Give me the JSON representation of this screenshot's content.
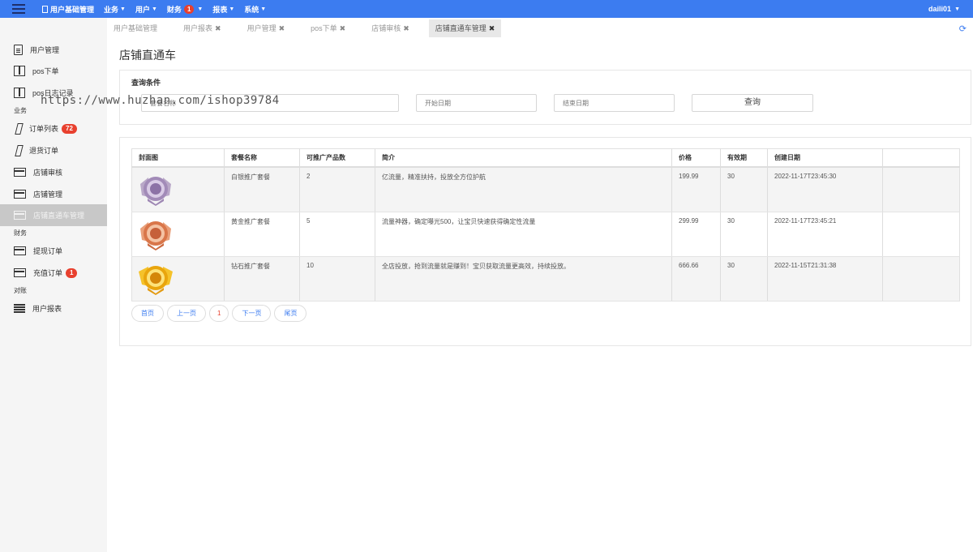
{
  "topbar": {
    "nav": [
      {
        "label": "用户基础管理",
        "icon": "document-icon"
      },
      {
        "label": "业务",
        "caret": true
      },
      {
        "label": "用户",
        "caret": true
      },
      {
        "label": "财务",
        "badge": "1",
        "caret": true
      },
      {
        "label": "报表",
        "caret": true
      },
      {
        "label": "系统",
        "caret": true
      }
    ],
    "user": "daili01",
    "colors": {
      "bar": "#3c7cf0",
      "badge": "#e8402e"
    }
  },
  "sidebar": {
    "items": [
      {
        "label": "用户管理",
        "icon": "document-icon"
      },
      {
        "label": "pos下单",
        "icon": "columns-icon"
      },
      {
        "label": "pos日志记录",
        "icon": "columns-icon"
      },
      {
        "label": "订单列表",
        "icon": "slash-icon",
        "badge": "72"
      },
      {
        "label": "退货订单",
        "icon": "slash-icon"
      },
      {
        "label": "店铺审核",
        "icon": "card-icon"
      },
      {
        "label": "店铺管理",
        "icon": "card-icon"
      },
      {
        "label": "店铺直通车管理",
        "icon": "card-icon",
        "active": true
      },
      {
        "label": "提现订单",
        "icon": "card-icon"
      },
      {
        "label": "充值订单",
        "icon": "card-icon",
        "badge": "1"
      },
      {
        "label": "用户报表",
        "icon": "list-icon"
      }
    ],
    "sections": [
      "业务",
      "财务",
      "对账"
    ]
  },
  "watermark": "https://www.huzhan.com/ishop39784",
  "tabs": [
    {
      "label": "用户基础管理",
      "closable": false
    },
    {
      "label": "用户报表",
      "closable": true
    },
    {
      "label": "用户管理",
      "closable": true
    },
    {
      "label": "pos下单",
      "closable": true
    },
    {
      "label": "店铺审核",
      "closable": true
    },
    {
      "label": "店铺直通车管理",
      "closable": true,
      "active": true
    }
  ],
  "page_title": "店铺直通车",
  "query": {
    "label": "查询条件",
    "keyword_placeholder": "套餐名称",
    "start_placeholder": "开始日期",
    "end_placeholder": "结束日期",
    "search_button": "查询"
  },
  "table": {
    "headers": [
      "封面图",
      "套餐名称",
      "可推广产品数",
      "简介",
      "价格",
      "有效期",
      "创建日期",
      ""
    ],
    "rows": [
      {
        "medal": "silver",
        "name": "白银推广套餐",
        "count": "2",
        "desc": "亿流量，精准扶持，投放全方位护航",
        "price": "199.99",
        "days": "30",
        "created": "2022-11-17T23:45:30"
      },
      {
        "medal": "bronze",
        "name": "黄金推广套餐",
        "count": "5",
        "desc": "流量神器，确定曝光500，让宝贝快速获得确定性流量",
        "price": "299.99",
        "days": "30",
        "created": "2022-11-17T23:45:21"
      },
      {
        "medal": "gold",
        "name": "钻石推广套餐",
        "count": "10",
        "desc": "全店投放，抢到流量就是赚到！宝贝获取流量更高效，持续投放。",
        "price": "666.66",
        "days": "30",
        "created": "2022-11-15T21:31:38"
      }
    ]
  },
  "pager": {
    "first": "首页",
    "prev": "上一页",
    "current": "1",
    "next": "下一页",
    "last": "尾页"
  }
}
